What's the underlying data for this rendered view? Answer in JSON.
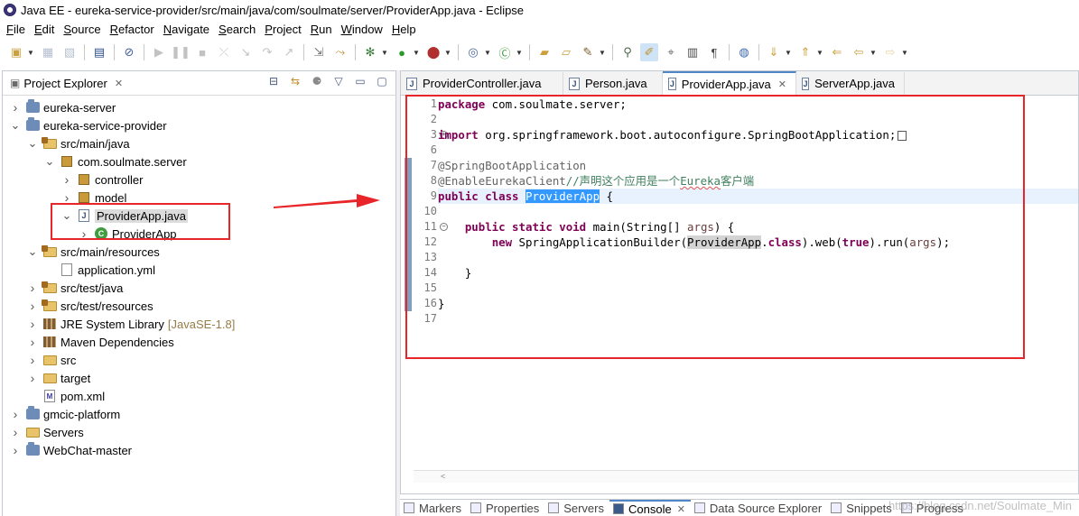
{
  "window": {
    "title": "Java EE - eureka-service-provider/src/main/java/com/soulmate/server/ProviderApp.java - Eclipse"
  },
  "menu": [
    "File",
    "Edit",
    "Source",
    "Refactor",
    "Navigate",
    "Search",
    "Project",
    "Run",
    "Window",
    "Help"
  ],
  "explorer": {
    "title": "Project Explorer",
    "tree": [
      {
        "label": "eureka-server",
        "depth": 0,
        "twisty": "collapsed",
        "icon": "project"
      },
      {
        "label": "eureka-service-provider",
        "depth": 0,
        "twisty": "expanded",
        "icon": "project"
      },
      {
        "label": "src/main/java",
        "depth": 1,
        "twisty": "expanded",
        "icon": "srcfolder"
      },
      {
        "label": "com.soulmate.server",
        "depth": 2,
        "twisty": "expanded",
        "icon": "package"
      },
      {
        "label": "controller",
        "depth": 3,
        "twisty": "collapsed",
        "icon": "package"
      },
      {
        "label": "model",
        "depth": 3,
        "twisty": "collapsed",
        "icon": "package"
      },
      {
        "label": "ProviderApp.java",
        "depth": 3,
        "twisty": "expanded",
        "icon": "java",
        "selected": true
      },
      {
        "label": "ProviderApp",
        "depth": 4,
        "twisty": "collapsed",
        "icon": "class"
      },
      {
        "label": "src/main/resources",
        "depth": 1,
        "twisty": "expanded",
        "icon": "srcfolder"
      },
      {
        "label": "application.yml",
        "depth": 2,
        "twisty": "none",
        "icon": "file"
      },
      {
        "label": "src/test/java",
        "depth": 1,
        "twisty": "collapsed",
        "icon": "srcfolder"
      },
      {
        "label": "src/test/resources",
        "depth": 1,
        "twisty": "collapsed",
        "icon": "srcfolder"
      },
      {
        "label": "JRE System Library",
        "decor": "[JavaSE-1.8]",
        "depth": 1,
        "twisty": "collapsed",
        "icon": "lib"
      },
      {
        "label": "Maven Dependencies",
        "depth": 1,
        "twisty": "collapsed",
        "icon": "lib"
      },
      {
        "label": "src",
        "depth": 1,
        "twisty": "collapsed",
        "icon": "folder"
      },
      {
        "label": "target",
        "depth": 1,
        "twisty": "collapsed",
        "icon": "folder"
      },
      {
        "label": "pom.xml",
        "depth": 1,
        "twisty": "none",
        "icon": "xml"
      },
      {
        "label": "gmcic-platform",
        "depth": 0,
        "twisty": "collapsed",
        "icon": "project"
      },
      {
        "label": "Servers",
        "depth": 0,
        "twisty": "collapsed",
        "icon": "folder"
      },
      {
        "label": "WebChat-master",
        "depth": 0,
        "twisty": "collapsed",
        "icon": "project"
      }
    ]
  },
  "editor": {
    "tabs": [
      {
        "label": "ProviderController.java",
        "active": false
      },
      {
        "label": "Person.java",
        "active": false
      },
      {
        "label": "ProviderApp.java",
        "active": true
      },
      {
        "label": "ServerApp.java",
        "active": false
      }
    ],
    "line_numbers": [
      "1",
      "2",
      "3",
      "6",
      "7",
      "8",
      "9",
      "10",
      "11",
      "12",
      "13",
      "14",
      "15",
      "16",
      "17"
    ],
    "code": {
      "l1_kw": "package",
      "l1_rest": " com.soulmate.server;",
      "l3_kw": "import",
      "l3_rest": " org.springframework.boot.autoconfigure.SpringBootApplication;",
      "l7": "@SpringBootApplication",
      "l8_ann": "@EnableEurekaClient",
      "l8_cmt_a": "//声明这个应用是一个",
      "l8_cmt_b": "Eureka",
      "l8_cmt_c": "客户端",
      "l9_kw": "public class",
      "l9_sel": "ProviderApp",
      "l9_rest": " {",
      "l11_kw": "public static void",
      "l11_rest": " main(String[] ",
      "l11_param": "args",
      "l11_end": ") {",
      "l12_kw": "new",
      "l12_a": " SpringApplicationBuilder(",
      "l12_occ": "ProviderApp",
      "l12_dot": ".",
      "l12_cls": "class",
      "l12_b": ").web(",
      "l12_true": "true",
      "l12_c": ").run(",
      "l12_param": "args",
      "l12_d": ");",
      "l14": "}",
      "l16": "}"
    }
  },
  "bottom_tabs": [
    {
      "label": "Markers",
      "active": false
    },
    {
      "label": "Properties",
      "active": false
    },
    {
      "label": "Servers",
      "active": false
    },
    {
      "label": "Console",
      "active": true
    },
    {
      "label": "Data Source Explorer",
      "active": false
    },
    {
      "label": "Snippets",
      "active": false
    },
    {
      "label": "Progress",
      "active": false
    }
  ],
  "watermark": "https://blog.csdn.net/Soulmate_Min",
  "colors": {
    "annotation_red": "#e8262a",
    "keyword": "#7f0055",
    "comment": "#3f7f5f",
    "selection": "#3399ff",
    "current_line": "#e8f2fe"
  }
}
